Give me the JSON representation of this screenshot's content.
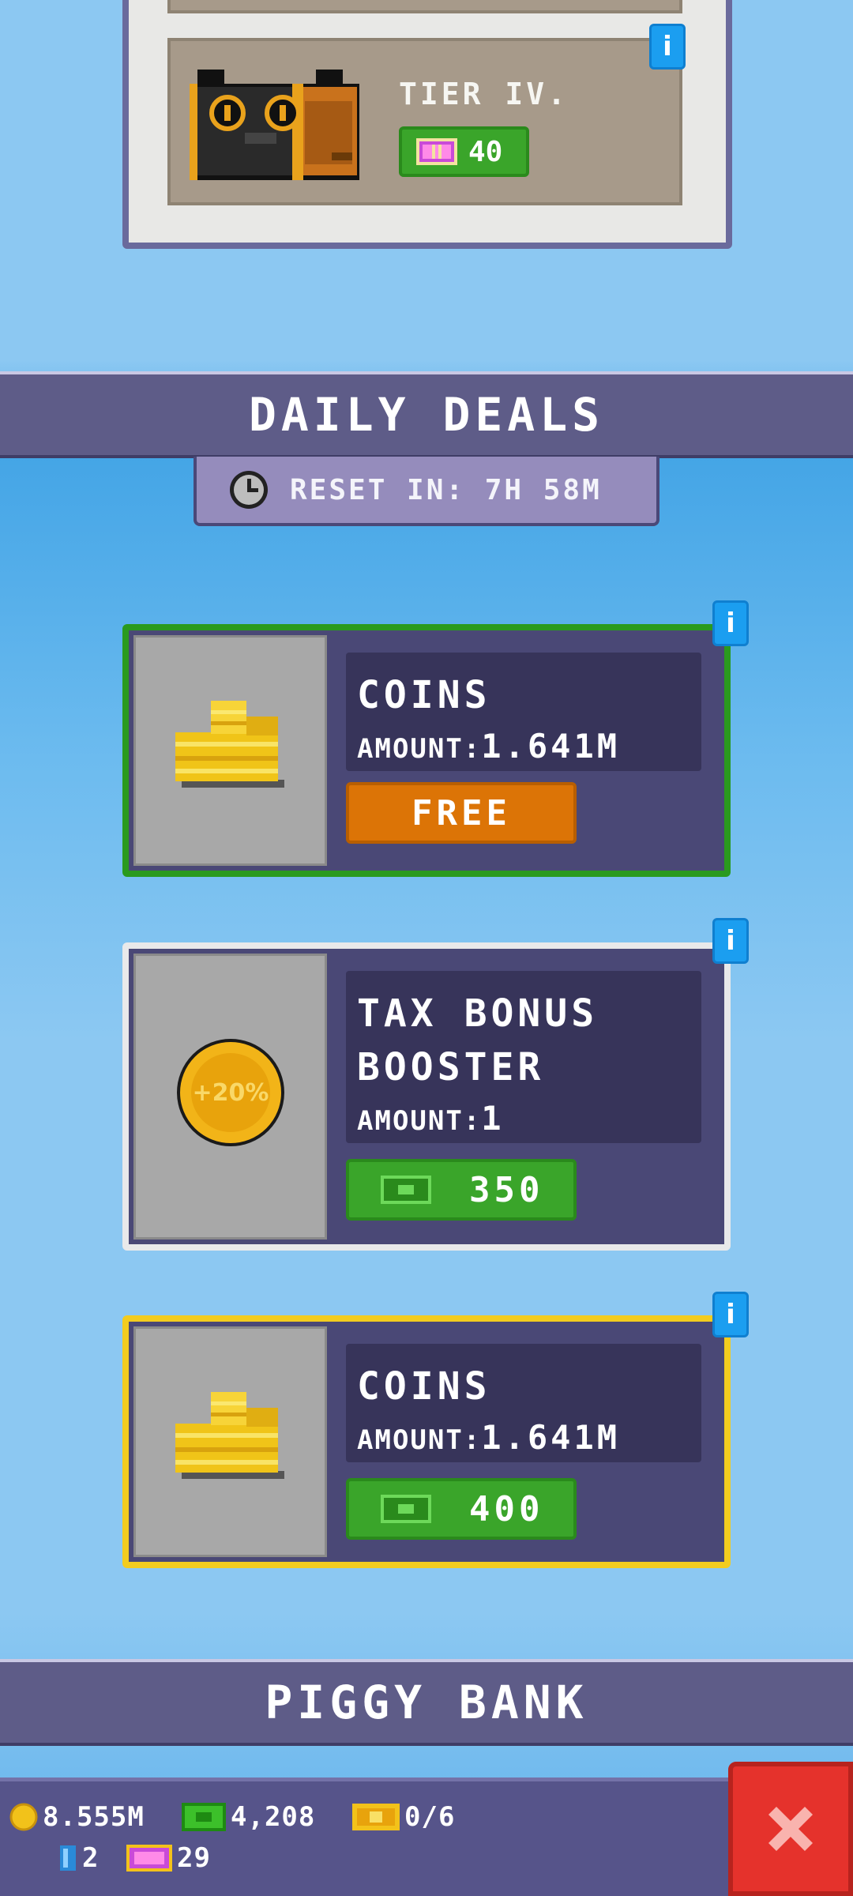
{
  "tier_card": {
    "label": "TIER IV.",
    "price": "40",
    "chest_icon": "treasure-chest-icon",
    "currency_icon": "ticket-icon"
  },
  "daily_deals": {
    "title": "DAILY DEALS",
    "reset_label": "RESET IN: 7H 58M",
    "deals": [
      {
        "name": "COINS",
        "amount_label": "AMOUNT:",
        "amount_value": "1.641M",
        "button_label": "FREE",
        "icon": "coin-stack-icon",
        "frame_color": "#2a9a1e"
      },
      {
        "name_line1": "TAX BONUS",
        "name_line2": "BOOSTER",
        "amount_label": "AMOUNT:",
        "amount_value": "1",
        "price": "350",
        "icon": "tax-bonus-coin-icon",
        "badge_text": "+20%",
        "frame_color": "#e9e9ea"
      },
      {
        "name": "COINS",
        "amount_label": "AMOUNT:",
        "amount_value": "1.641M",
        "price": "400",
        "icon": "coin-stack-icon",
        "frame_color": "#f3cc1f"
      }
    ]
  },
  "piggy_bank": {
    "title": "PIGGY BANK"
  },
  "info_label": "i",
  "currencies": {
    "coins": "8.555M",
    "cash": "4,208",
    "tickets_gold": "0/6",
    "gems": "2",
    "tickets_purple": "29"
  }
}
